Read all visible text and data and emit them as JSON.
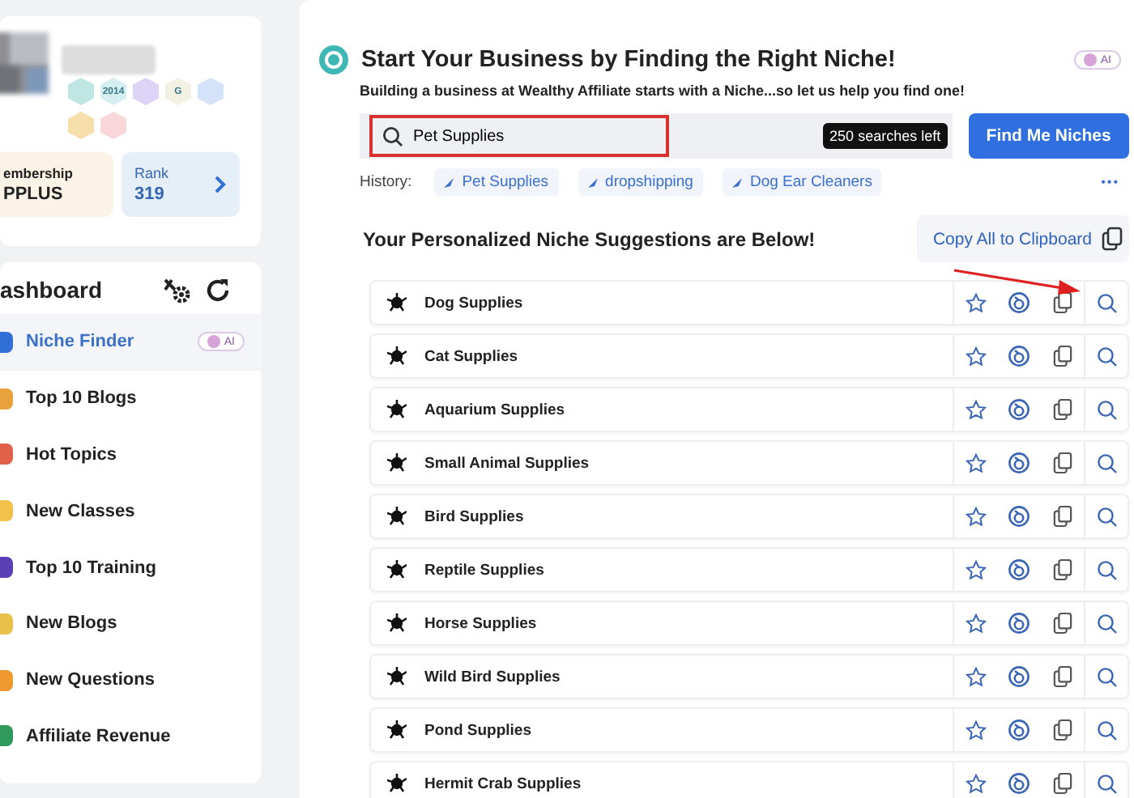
{
  "profile": {
    "badges": [
      {
        "kind": "person"
      },
      {
        "kind": "year",
        "text": "2014"
      },
      {
        "kind": "gem"
      },
      {
        "kind": "letter",
        "text": "G"
      },
      {
        "kind": "card"
      },
      {
        "kind": "medal"
      },
      {
        "kind": "heart"
      }
    ],
    "membership": {
      "label": "embership",
      "value": "PPLUS"
    },
    "rank": {
      "label": "Rank",
      "value": "319"
    }
  },
  "dashboard": {
    "title": "ashboard",
    "items": [
      {
        "label": "Niche Finder",
        "selected": true,
        "badge": "AI",
        "color": "#2f6fd6"
      },
      {
        "label": "Top 10 Blogs",
        "selected": false,
        "color": "#e9a23b"
      },
      {
        "label": "Hot Topics",
        "selected": false,
        "color": "#e0604a"
      },
      {
        "label": "New Classes",
        "selected": false,
        "color": "#f2c14b"
      },
      {
        "label": "Top 10 Training",
        "selected": false,
        "color": "#5a3fb5"
      },
      {
        "label": "New Blogs",
        "selected": false,
        "color": "#e8c04a"
      },
      {
        "label": "New Questions",
        "selected": false,
        "color": "#ee9a2e"
      },
      {
        "label": "Affiliate Revenue",
        "selected": false,
        "color": "#2f9a5a"
      }
    ]
  },
  "main": {
    "title": "Start Your Business by Finding the Right Niche!",
    "ai_badge": "AI",
    "subtitle": "Building a business at Wealthy Affiliate starts with a Niche...so let us help you find one!",
    "search": {
      "value": "Pet Supplies"
    },
    "searches_left": "250 searches left",
    "find_button": "Find Me Niches",
    "history_label": "History:",
    "history": [
      "Pet Supplies",
      "dropshipping",
      "Dog Ear Cleaners"
    ],
    "more": "•••",
    "suggestions_title": "Your Personalized Niche Suggestions are Below!",
    "copy_all": "Copy All to Clipboard",
    "niches": [
      "Dog Supplies",
      "Cat Supplies",
      "Aquarium Supplies",
      "Small Animal Supplies",
      "Bird Supplies",
      "Reptile Supplies",
      "Horse Supplies",
      "Wild Bird Supplies",
      "Pond Supplies",
      "Hermit Crab Supplies"
    ]
  }
}
